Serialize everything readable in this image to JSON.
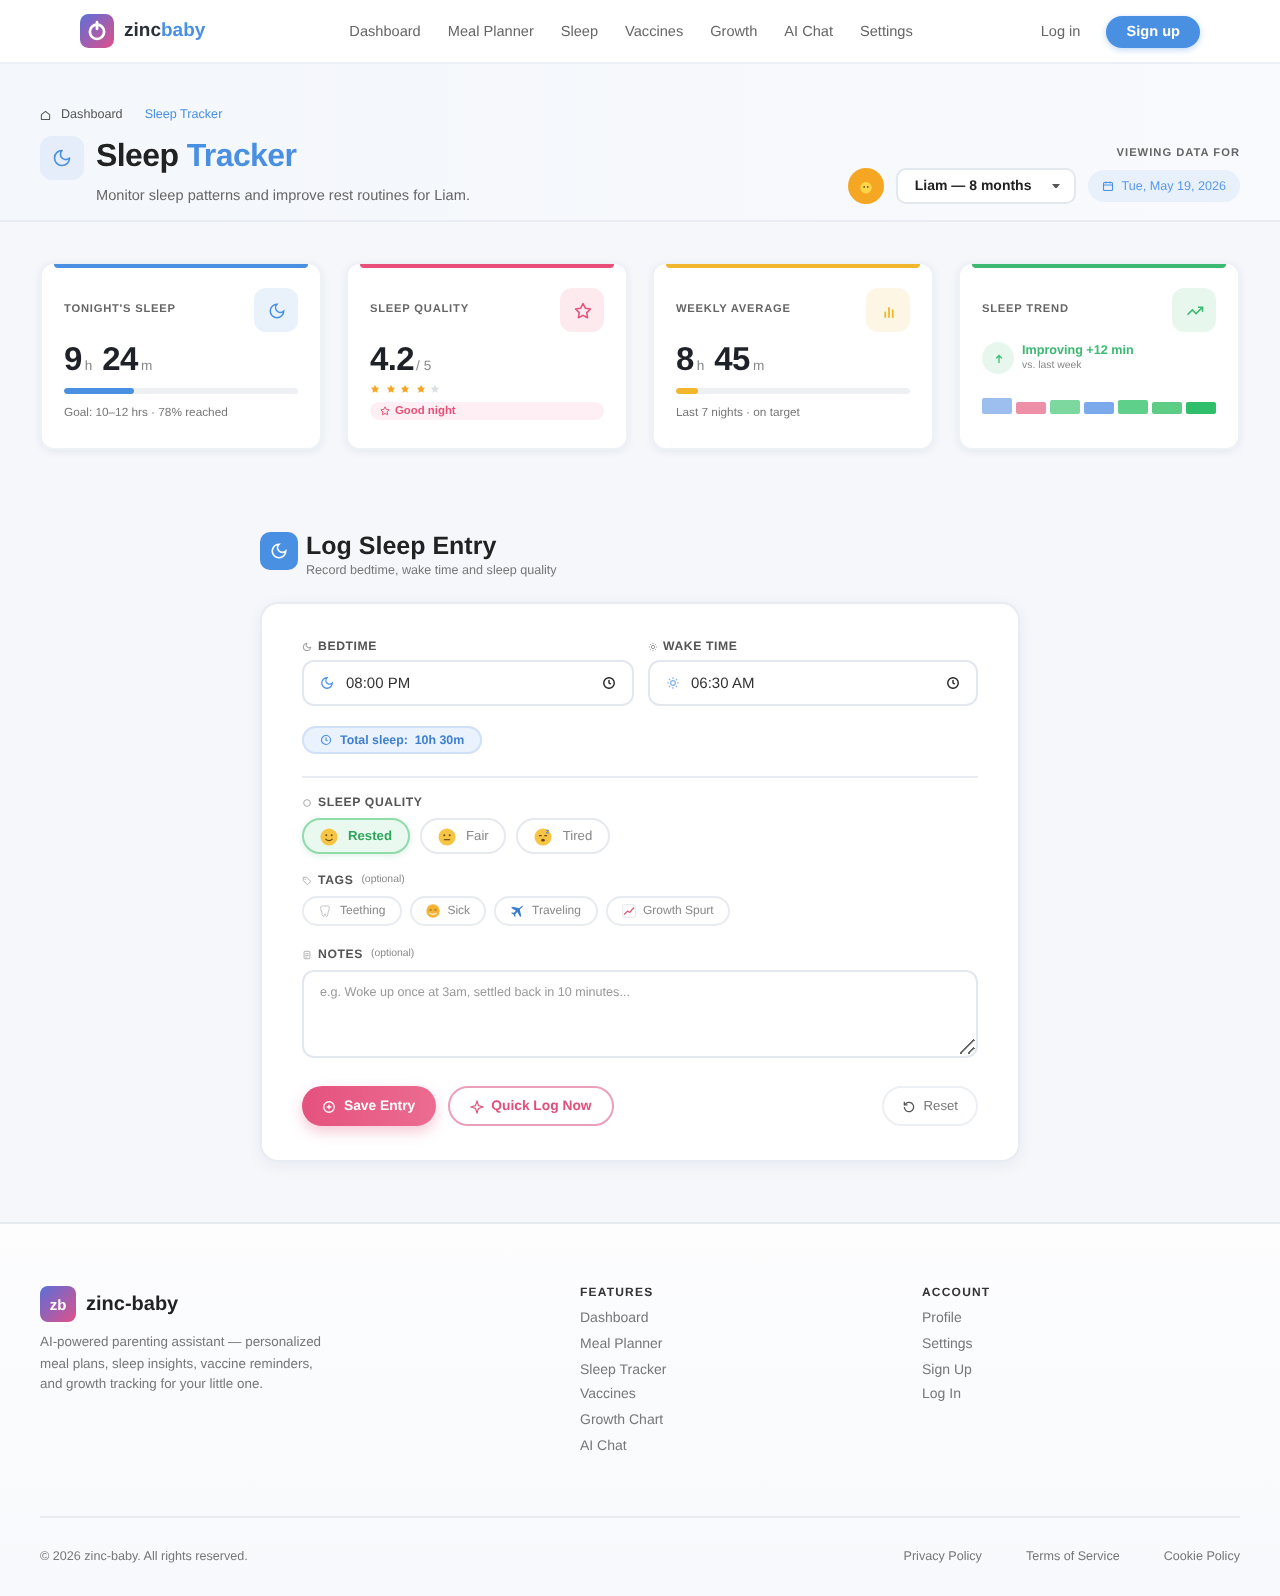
{
  "nav": {
    "brand": "zinc",
    "brand_accent": "baby",
    "links": [
      "Dashboard",
      "Meal Planner",
      "Sleep",
      "Vaccines",
      "Growth",
      "AI Chat",
      "Settings"
    ],
    "login": "Log in",
    "signup": "Sign up"
  },
  "hero": {
    "breadcrumb": [
      "Dashboard",
      "Sleep Tracker"
    ],
    "title": "Sleep",
    "title_accent": "Tracker",
    "subtitle": "Monitor sleep patterns and improve rest routines for Liam.",
    "viewing_label": "VIEWING DATA FOR",
    "child_select": "Liam — 8 months",
    "date": "Tue, May 19, 2026"
  },
  "stats": [
    {
      "kind": "duration",
      "label": "TONIGHT'S SLEEP",
      "color": "#4a90e2",
      "hours": "9",
      "hours_unit": "h",
      "minutes": "24",
      "minutes_unit": "m",
      "level": 0.3,
      "note": "Goal: 10–12 hrs · 78% reached"
    },
    {
      "kind": "rating",
      "label": "SLEEP QUALITY",
      "color": "#e8507a",
      "value": "4.2",
      "scale": "/ 5",
      "stars": 4,
      "badge": "Good night"
    },
    {
      "kind": "duration",
      "label": "WEEKLY AVERAGE",
      "color": "#f2b62c",
      "hours": "8",
      "hours_unit": "h",
      "minutes": "45",
      "minutes_unit": "m",
      "level": 0.09,
      "note": "Last 7 nights · on target"
    },
    {
      "kind": "trend",
      "label": "SLEEP TREND",
      "color": "#3cba72",
      "headline": "Improving +12 min",
      "sub": "vs. last week"
    }
  ],
  "log": {
    "title": "Log Sleep Entry",
    "subtitle": "Record bedtime, wake time and sleep quality",
    "times": [
      {
        "label": "BEDTIME",
        "value": "08:00 PM"
      },
      {
        "label": "WAKE TIME",
        "value": "06:30 AM"
      }
    ],
    "total": "Total sleep:  10h 30m",
    "quality": {
      "label": "SLEEP QUALITY",
      "options": [
        {
          "label": "Rested",
          "selected": true
        },
        {
          "label": "Fair",
          "selected": false
        },
        {
          "label": "Tired",
          "selected": false
        }
      ]
    },
    "tags": {
      "label": "TAGS",
      "hint": "(optional)",
      "options": [
        {
          "label": "Teething",
          "selected": false
        },
        {
          "label": "Sick",
          "selected": false
        },
        {
          "label": "Traveling",
          "selected": false
        },
        {
          "label": "Growth Spurt",
          "selected": false
        }
      ]
    },
    "notes": {
      "label": "NOTES",
      "hint": "(optional)",
      "placeholder": "e.g. Woke up once at 3am, settled back in 10 minutes..."
    },
    "buttons": [
      {
        "kind": "primary",
        "label": "Save Entry"
      },
      {
        "kind": "outline",
        "label": "Quick Log Now"
      },
      {
        "kind": "reset",
        "label": "Reset"
      }
    ]
  },
  "footer": {
    "logo": "zb",
    "brand": "zinc-baby",
    "description": "AI-powered parenting assistant — personalized meal plans, sleep insights, vaccine reminders, and growth tracking for your little one.",
    "columns": [
      {
        "title": "FEATURES",
        "links": [
          "Dashboard",
          "Meal Planner",
          "Sleep Tracker",
          "Vaccines",
          "Growth Chart",
          "AI Chat"
        ]
      },
      {
        "title": "ACCOUNT",
        "links": [
          "Profile",
          "Settings",
          "Sign Up",
          "Log In"
        ]
      }
    ],
    "copyright": "© 2026 zinc-baby. All rights reserved.",
    "legal": [
      "Privacy Policy",
      "Terms of Service",
      "Cookie Policy"
    ]
  }
}
